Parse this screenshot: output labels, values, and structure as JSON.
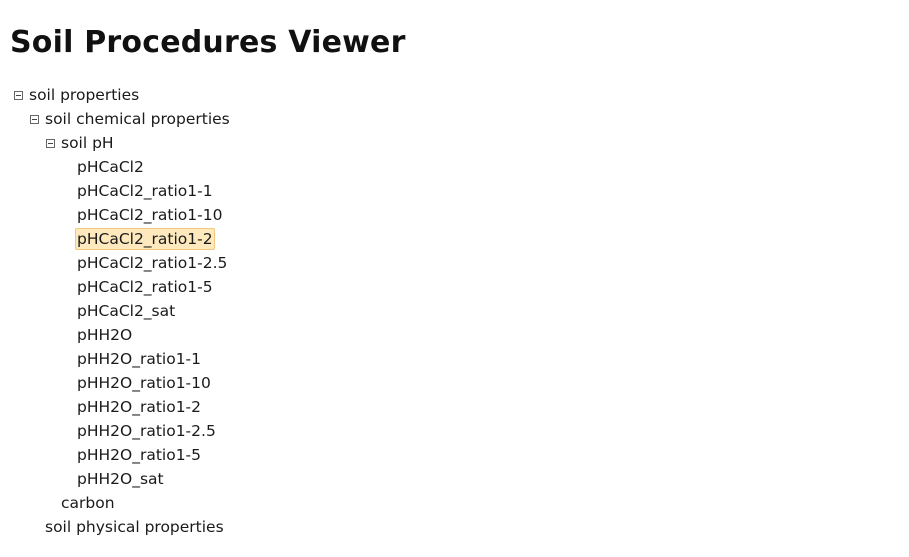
{
  "page": {
    "title": "Soil Procedures Viewer"
  },
  "tree": {
    "root": {
      "label": "soil properties",
      "expanded": true,
      "children": {
        "chemical": {
          "label": "soil chemical properties",
          "expanded": true,
          "children": {
            "soil_ph": {
              "label": "soil pH",
              "expanded": true,
              "items": [
                "pHCaCl2",
                "pHCaCl2_ratio1-1",
                "pHCaCl2_ratio1-10",
                "pHCaCl2_ratio1-2",
                "pHCaCl2_ratio1-2.5",
                "pHCaCl2_ratio1-5",
                "pHCaCl2_sat",
                "pHH2O",
                "pHH2O_ratio1-1",
                "pHH2O_ratio1-10",
                "pHH2O_ratio1-2",
                "pHH2O_ratio1-2.5",
                "pHH2O_ratio1-5",
                "pHH2O_sat"
              ],
              "selected_item": "pHCaCl2_ratio1-2"
            },
            "carbon": {
              "label": "carbon"
            }
          }
        },
        "physical": {
          "label": "soil physical properties"
        }
      }
    }
  },
  "colors": {
    "selection_background": "#fde9bd",
    "selection_border": "#f2c97a"
  }
}
